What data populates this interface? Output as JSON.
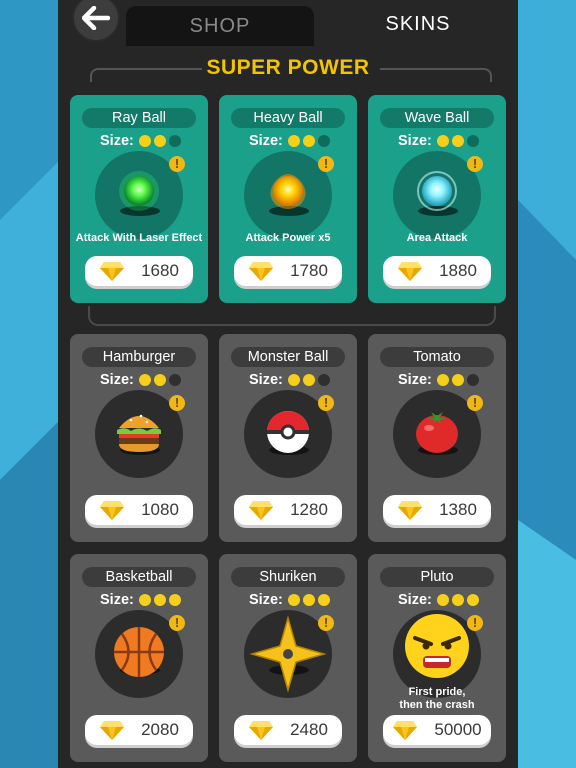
{
  "tabs": {
    "shop": "SHOP",
    "skins": "SKINS",
    "active": "SKINS"
  },
  "back_icon": "arrow-left-icon",
  "section": {
    "title": "SUPER POWER"
  },
  "size_label": "Size:",
  "colors": {
    "accent": "#f5c400",
    "super_card": "#1aa08b",
    "normal_card": "#5a5a5a",
    "panel": "#262626"
  },
  "cards": [
    {
      "name": "Ray Ball",
      "size": 2,
      "price": "1680",
      "desc": "Attack With Laser Effect",
      "icon": "green-energy-ball-icon",
      "tier": "super"
    },
    {
      "name": "Heavy Ball",
      "size": 2,
      "price": "1780",
      "desc": "Attack Power x5",
      "icon": "yellow-energy-ball-icon",
      "tier": "super"
    },
    {
      "name": "Wave Ball",
      "size": 2,
      "price": "1880",
      "desc": "Area Attack",
      "icon": "cyan-energy-ball-icon",
      "tier": "super"
    },
    {
      "name": "Hamburger",
      "size": 2,
      "price": "1080",
      "desc": "",
      "icon": "hamburger-icon",
      "tier": "normal"
    },
    {
      "name": "Monster Ball",
      "size": 2,
      "price": "1280",
      "desc": "",
      "icon": "pokeball-icon",
      "tier": "normal"
    },
    {
      "name": "Tomato",
      "size": 2,
      "price": "1380",
      "desc": "",
      "icon": "tomato-icon",
      "tier": "normal"
    },
    {
      "name": "Basketball",
      "size": 3,
      "price": "2080",
      "desc": "",
      "icon": "basketball-icon",
      "tier": "normal"
    },
    {
      "name": "Shuriken",
      "size": 3,
      "price": "2480",
      "desc": "",
      "icon": "shuriken-icon",
      "tier": "normal"
    },
    {
      "name": "Pluto",
      "size": 3,
      "price": "50000",
      "desc": "First pride,\nthen the crash",
      "icon": "angry-face-icon",
      "tier": "normal"
    }
  ]
}
